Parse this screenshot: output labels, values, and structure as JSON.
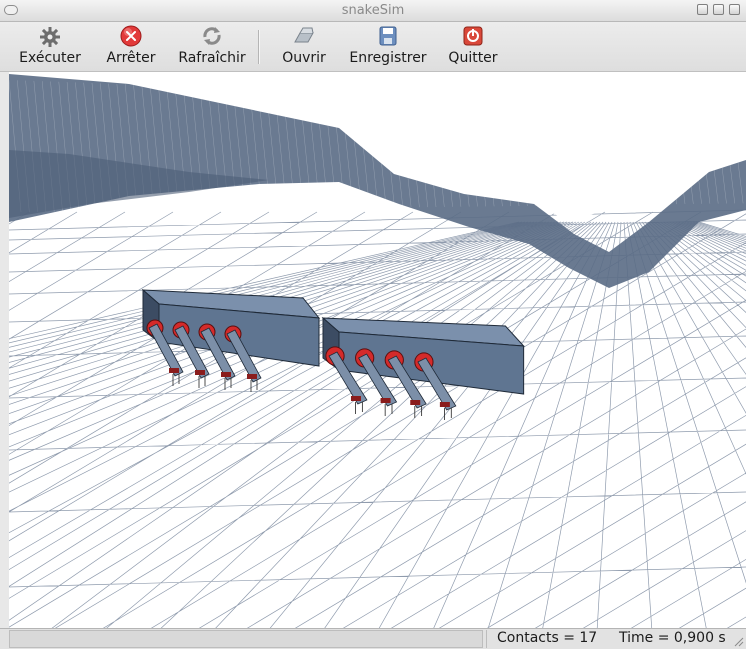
{
  "window": {
    "title": "snakeSim"
  },
  "toolbar": {
    "items": [
      {
        "label": "Exécuter",
        "icon": "gear-icon"
      },
      {
        "label": "Arrêter",
        "icon": "stop-icon"
      },
      {
        "label": "Rafraîchir",
        "icon": "refresh-icon"
      },
      {
        "label": "Ouvrir",
        "icon": "open-icon"
      },
      {
        "label": "Enregistrer",
        "icon": "save-icon"
      },
      {
        "label": "Quitter",
        "icon": "quit-icon"
      }
    ]
  },
  "status": {
    "contacts": "Contacts = 17",
    "time": "Time = 0,900 s"
  },
  "colors": {
    "terrain_mesh": "#5a6c85",
    "robot_body": "#5f7591",
    "wheel": "#d42a2a",
    "floor_grid": "#6a7a92"
  }
}
